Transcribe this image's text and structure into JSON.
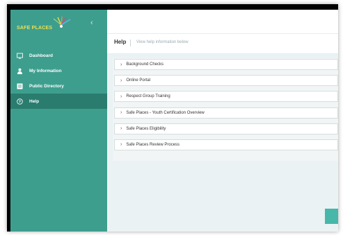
{
  "brand": {
    "logo_text": "SAFE PLACES"
  },
  "sidebar": {
    "items": [
      {
        "label": "Dashboard",
        "icon": "dashboard-icon"
      },
      {
        "label": "My Information",
        "icon": "user-icon"
      },
      {
        "label": "Public Directory",
        "icon": "directory-icon"
      },
      {
        "label": "Help",
        "icon": "help-icon",
        "active": true
      }
    ]
  },
  "header": {
    "title": "Help",
    "subtitle": "View help information below"
  },
  "help_topics": [
    "Background Checks",
    "Online Portal",
    "Respect Group Training",
    "Safe Places - Youth Certification Overview",
    "Safe Places Eligibility",
    "Safe Places Review Process"
  ],
  "colors": {
    "sidebar": "#3d9e8e",
    "sidebar_active": "#2a7c6f",
    "accent_button": "#46b7a8",
    "logo_yellow": "#f2e04a"
  }
}
